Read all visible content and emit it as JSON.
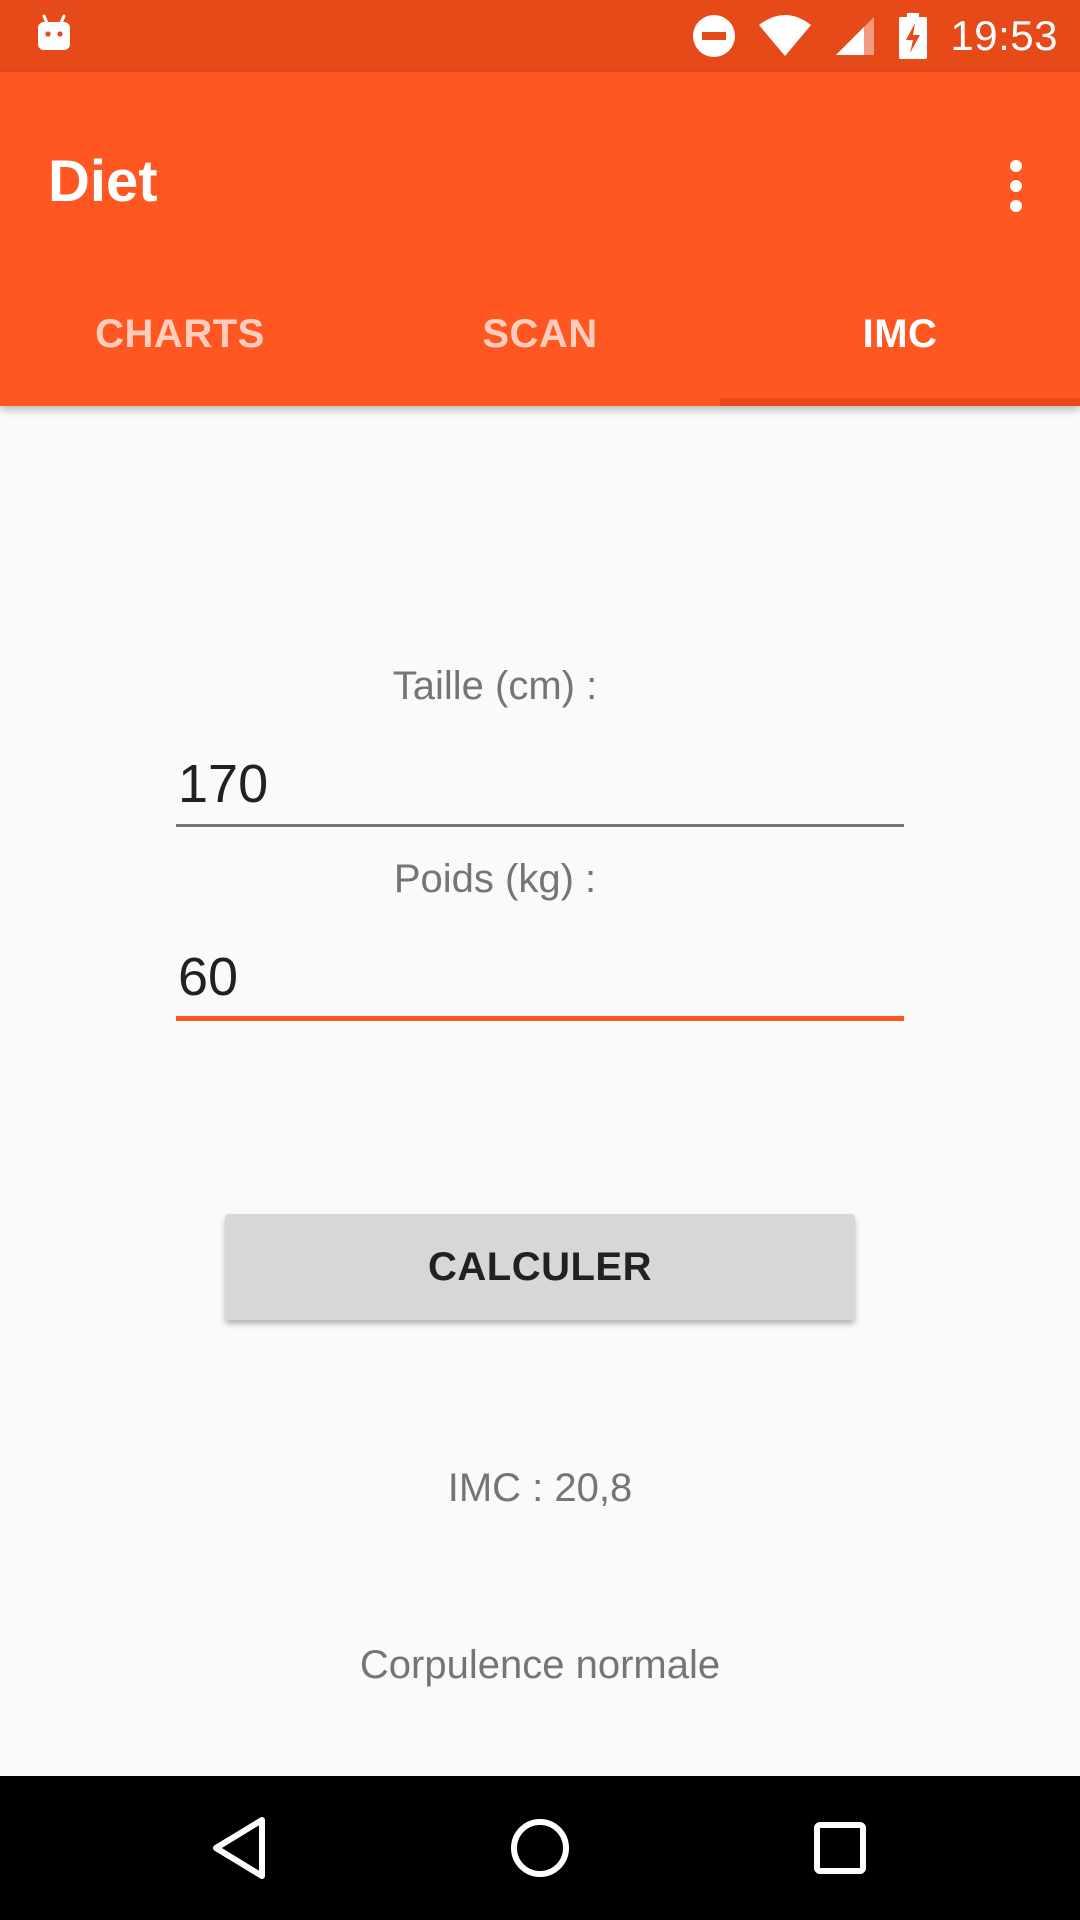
{
  "status_bar": {
    "time": "19:53",
    "icons": [
      "android-icon",
      "do-not-disturb-icon",
      "wifi-icon",
      "signal-icon",
      "battery-charging-icon"
    ]
  },
  "app_bar": {
    "title": "Diet",
    "menu_icon": "more-vert-icon"
  },
  "tabs": [
    {
      "label": "CHARTS",
      "selected": false
    },
    {
      "label": "SCAN",
      "selected": false
    },
    {
      "label": "IMC",
      "selected": true
    }
  ],
  "form": {
    "height_label": "Taille (cm) :",
    "height_value": "170",
    "weight_label": "Poids (kg) :",
    "weight_value": "60",
    "calculate_button": "CALCULER"
  },
  "result": {
    "imc_text": "IMC : 20,8",
    "category_text": "Corpulence normale"
  },
  "nav_bar": {
    "icons": [
      "back-icon",
      "home-icon",
      "recents-icon"
    ]
  },
  "colors": {
    "status_bar": "#E64A19",
    "app_bar": "#FF5722",
    "accent": "#FF5722",
    "background": "#FAFAFA",
    "button": "#D6D7D7"
  }
}
